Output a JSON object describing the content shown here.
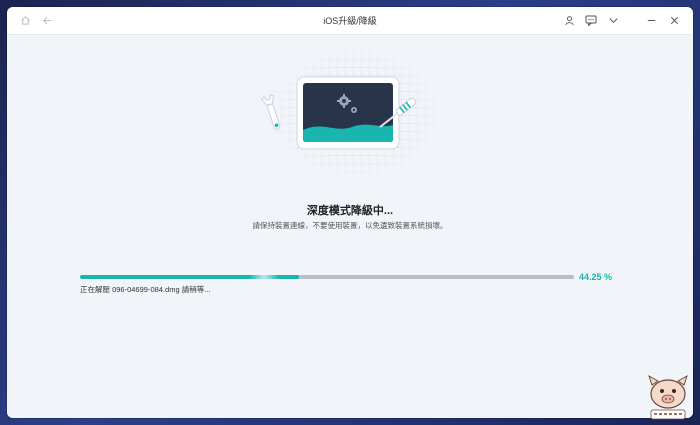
{
  "window": {
    "title": "iOS升級/降級"
  },
  "main": {
    "heading": "深度模式降級中...",
    "subtext": "請保持裝置連線，不要使用裝置，以免遺致裝置系統損壞。",
    "progress": {
      "percent_label": "44.25 %",
      "fraction": 0.4425
    },
    "status_text": "正在解壓 096-04699-084.dmg 請稍等..."
  },
  "colors": {
    "accent": "#19b6b0",
    "track": "#b6bfca",
    "background": "#f1f5fa"
  },
  "icons": [
    "home-icon",
    "back-arrow-icon",
    "user-icon",
    "feedback-icon",
    "chevron-down-icon",
    "minimize-icon",
    "close-icon"
  ]
}
